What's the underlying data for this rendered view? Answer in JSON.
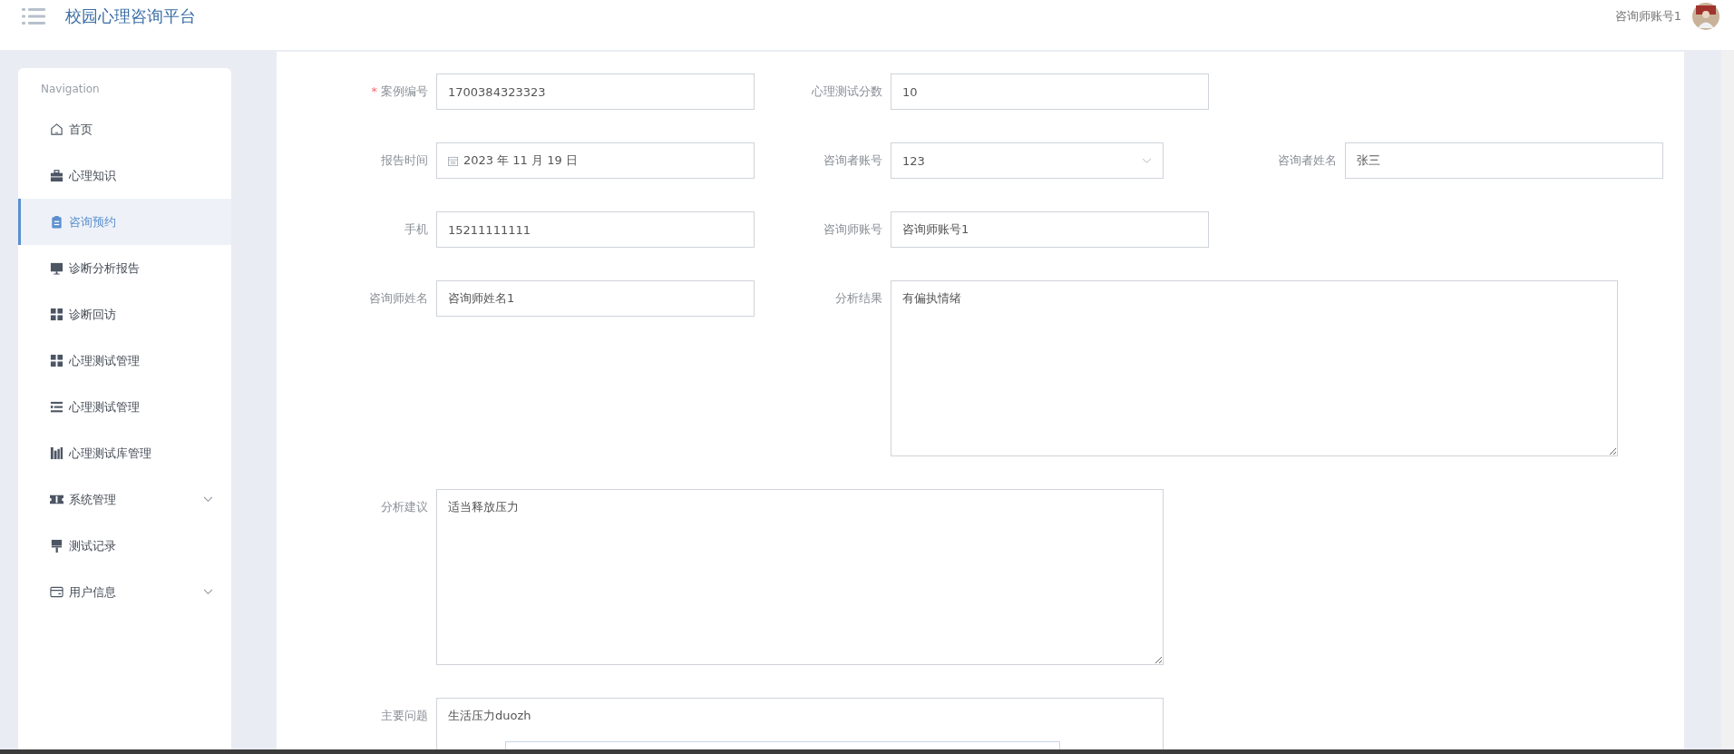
{
  "header": {
    "title": "校园心理咨询平台",
    "user": "咨询师账号1"
  },
  "sidebar": {
    "heading": "Navigation",
    "items": [
      {
        "label": "首页",
        "kind": "home",
        "selected": false
      },
      {
        "label": "心理知识",
        "kind": "briefcase",
        "selected": false
      },
      {
        "label": "咨询预约",
        "kind": "clipboard",
        "selected": true
      },
      {
        "label": "诊断分析报告",
        "kind": "monitor",
        "selected": false
      },
      {
        "label": "诊断回访",
        "kind": "grid",
        "selected": false
      },
      {
        "label": "心理测试管理",
        "kind": "grid",
        "selected": false
      },
      {
        "label": "心理测试管理",
        "kind": "list",
        "selected": false
      },
      {
        "label": "心理测试库管理",
        "kind": "books",
        "selected": false
      },
      {
        "label": "系统管理",
        "kind": "ticket",
        "selected": false,
        "expanded": false
      },
      {
        "label": "测试记录",
        "kind": "brush",
        "selected": false
      },
      {
        "label": "用户信息",
        "kind": "card",
        "selected": false,
        "expanded": false
      }
    ]
  },
  "form": {
    "fields": [
      {
        "label": "案例编号",
        "kind": "text",
        "value": "1700384323323",
        "marker": "*"
      },
      {
        "label": "心理测试分数",
        "kind": "text",
        "value": "10"
      },
      {
        "label": "报告时间",
        "kind": "date",
        "value": "2023 年 11 月 19 日"
      },
      {
        "label": "咨询者账号",
        "kind": "select",
        "value": "123"
      },
      {
        "label": "咨询者姓名",
        "kind": "text",
        "value": "张三"
      },
      {
        "label": "手机",
        "kind": "text",
        "value": "15211111111"
      },
      {
        "label": "咨询师账号",
        "kind": "text",
        "value": "咨询师账号1"
      },
      {
        "label": "咨询师姓名",
        "kind": "text",
        "value": "咨询师姓名1"
      },
      {
        "label": "分析结果",
        "kind": "textarea",
        "value": "有偏执情绪"
      },
      {
        "label": "分析建议",
        "kind": "textarea",
        "value": "适当释放压力"
      },
      {
        "label": "主要问题",
        "kind": "textarea",
        "value": "生活压力duozh"
      }
    ]
  }
}
